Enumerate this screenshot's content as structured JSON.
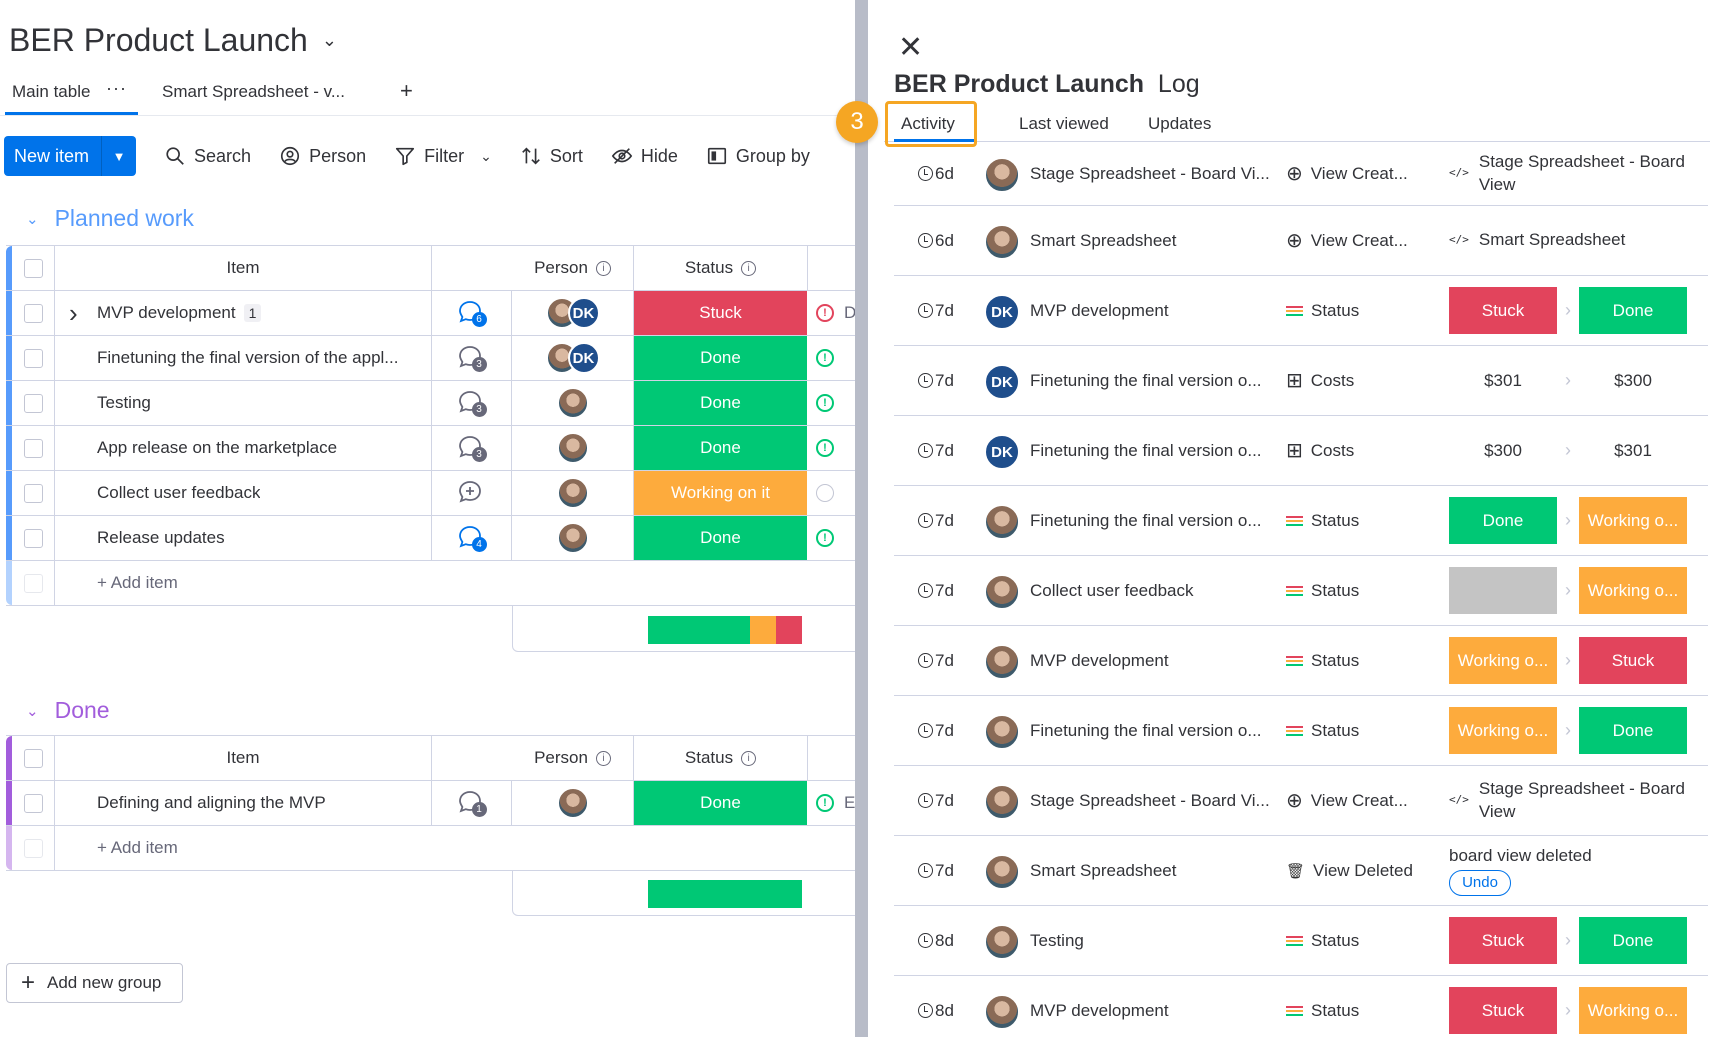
{
  "board": {
    "title": "BER Product Launch",
    "tabs": {
      "main": "Main table",
      "more": "···",
      "smart": "Smart Spreadsheet - v...",
      "add": "+"
    },
    "toolbar": {
      "new_item": "New item",
      "search": "Search",
      "person": "Person",
      "filter": "Filter",
      "sort": "Sort",
      "hide": "Hide",
      "group_by": "Group by"
    },
    "columns": {
      "item": "Item",
      "person": "Person",
      "status": "Status"
    },
    "groups": [
      {
        "name": "Planned work",
        "color": "#579bfc",
        "rows": [
          {
            "name": "MVP development",
            "subitems": "1",
            "updates": "6",
            "status": "Stuck",
            "status_color": "#e2445c",
            "has_dk": true,
            "extra": "D"
          },
          {
            "name": "Finetuning the final version of the appl...",
            "updates": "3",
            "status": "Done",
            "status_color": "#00c875",
            "has_dk": true
          },
          {
            "name": "Testing",
            "updates": "3",
            "status": "Done",
            "status_color": "#00c875"
          },
          {
            "name": "App release on the marketplace",
            "updates": "3",
            "status": "Done",
            "status_color": "#00c875"
          },
          {
            "name": "Collect user feedback",
            "updates": "",
            "status": "Working on it",
            "status_color": "#fdab3d"
          },
          {
            "name": "Release updates",
            "updates": "4",
            "status": "Done",
            "status_color": "#00c875"
          }
        ],
        "add_item": "+ Add item",
        "summary": [
          {
            "color": "#00c875",
            "fraction": 0.66
          },
          {
            "color": "#fdab3d",
            "fraction": 0.17
          },
          {
            "color": "#e2445c",
            "fraction": 0.17
          }
        ]
      },
      {
        "name": "Done",
        "color": "#a25ddc",
        "rows": [
          {
            "name": "Defining and aligning the MVP",
            "updates": "1",
            "status": "Done",
            "status_color": "#00c875",
            "extra": "E"
          }
        ],
        "add_item": "+ Add item",
        "summary": [
          {
            "color": "#00c875",
            "fraction": 1.0
          }
        ]
      }
    ],
    "add_group": "Add new group",
    "dk_initials": "DK"
  },
  "panel": {
    "title_bold": "BER Product Launch",
    "title_rest": "Log",
    "tabs": [
      "Activity",
      "Last viewed",
      "Updates"
    ],
    "step_badge": "3",
    "log": [
      {
        "time": "6d",
        "avatar": "photo",
        "item": "Stage Spreadsheet - Board Vi...",
        "column": "View Creat...",
        "col_icon": "plus-circle-icon",
        "kind": "text",
        "icon": "code-icon",
        "text": "Stage Spreadsheet - Board View"
      },
      {
        "time": "6d",
        "avatar": "photo",
        "item": "Smart Spreadsheet",
        "column": "View Creat...",
        "col_icon": "plus-circle-icon",
        "kind": "text",
        "icon": "code-icon",
        "text": "Smart Spreadsheet"
      },
      {
        "time": "7d",
        "avatar": "dk",
        "item": "MVP development",
        "column": "Status",
        "col_icon": "status-icon",
        "kind": "pills",
        "from": "Stuck",
        "from_color": "#e2445c",
        "to": "Done",
        "to_color": "#00c875"
      },
      {
        "time": "7d",
        "avatar": "dk",
        "item": "Finetuning the final version o...",
        "column": "Costs",
        "col_icon": "numbers-icon",
        "kind": "plain",
        "from": "$301",
        "to": "$300"
      },
      {
        "time": "7d",
        "avatar": "dk",
        "item": "Finetuning the final version o...",
        "column": "Costs",
        "col_icon": "numbers-icon",
        "kind": "plain",
        "from": "$300",
        "to": "$301"
      },
      {
        "time": "7d",
        "avatar": "photo",
        "item": "Finetuning the final version o...",
        "column": "Status",
        "col_icon": "status-icon",
        "kind": "pills",
        "from": "Done",
        "from_color": "#00c875",
        "to": "Working o...",
        "to_color": "#fdab3d"
      },
      {
        "time": "7d",
        "avatar": "photo",
        "item": "Collect user feedback",
        "column": "Status",
        "col_icon": "status-icon",
        "kind": "pills",
        "from": "",
        "from_color": "#c4c4c4",
        "to": "Working o...",
        "to_color": "#fdab3d"
      },
      {
        "time": "7d",
        "avatar": "photo",
        "item": "MVP development",
        "column": "Status",
        "col_icon": "status-icon",
        "kind": "pills",
        "from": "Working o...",
        "from_color": "#fdab3d",
        "to": "Stuck",
        "to_color": "#e2445c"
      },
      {
        "time": "7d",
        "avatar": "photo",
        "item": "Finetuning the final version o...",
        "column": "Status",
        "col_icon": "status-icon",
        "kind": "pills",
        "from": "Working o...",
        "from_color": "#fdab3d",
        "to": "Done",
        "to_color": "#00c875"
      },
      {
        "time": "7d",
        "avatar": "photo",
        "item": "Stage Spreadsheet - Board Vi...",
        "column": "View Creat...",
        "col_icon": "plus-circle-icon",
        "kind": "text",
        "icon": "code-icon",
        "text": "Stage Spreadsheet - Board View"
      },
      {
        "time": "7d",
        "avatar": "photo",
        "item": "Smart Spreadsheet",
        "column": "View Deleted",
        "col_icon": "trash-icon",
        "kind": "undo",
        "text": "board view deleted",
        "undo": "Undo"
      },
      {
        "time": "8d",
        "avatar": "photo",
        "item": "Testing",
        "column": "Status",
        "col_icon": "status-icon",
        "kind": "pills",
        "from": "Stuck",
        "from_color": "#e2445c",
        "to": "Done",
        "to_color": "#00c875"
      },
      {
        "time": "8d",
        "avatar": "photo",
        "item": "MVP development",
        "column": "Status",
        "col_icon": "status-icon",
        "kind": "pills",
        "from": "Stuck",
        "from_color": "#e2445c",
        "to": "Working o...",
        "to_color": "#fdab3d"
      }
    ]
  }
}
